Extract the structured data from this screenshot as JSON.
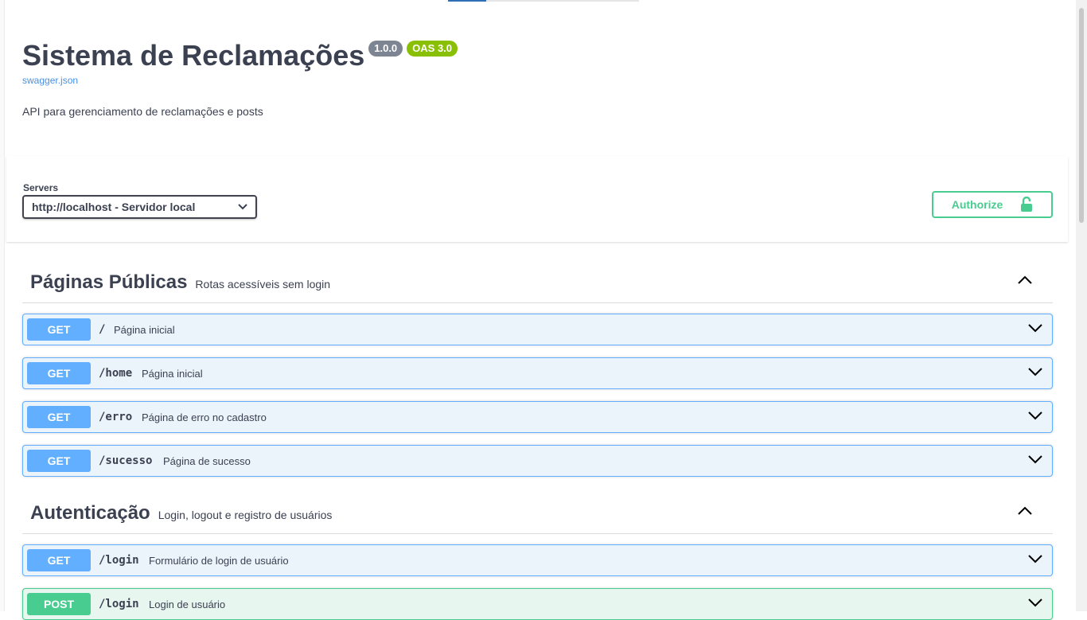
{
  "info": {
    "title": "Sistema de Reclamações",
    "version": "1.0.0",
    "oas": "OAS 3.0",
    "spec_link": "swagger.json",
    "description": "API para gerenciamento de reclamações e posts"
  },
  "servers": {
    "label": "Servers",
    "selected": "http://localhost - Servidor local"
  },
  "authorize": {
    "label": "Authorize"
  },
  "colors": {
    "get": "#61affe",
    "post": "#49cc90",
    "accent": "#4990e2"
  },
  "tags": [
    {
      "name": "Páginas Públicas",
      "description": "Rotas acessíveis sem login",
      "operations": [
        {
          "method": "GET",
          "path": "/",
          "summary": "Página inicial"
        },
        {
          "method": "GET",
          "path": "/home",
          "summary": "Página inicial"
        },
        {
          "method": "GET",
          "path": "/erro",
          "summary": "Página de erro no cadastro"
        },
        {
          "method": "GET",
          "path": "/sucesso",
          "summary": "Página de sucesso"
        }
      ]
    },
    {
      "name": "Autenticação",
      "description": "Login, logout e registro de usuários",
      "operations": [
        {
          "method": "GET",
          "path": "/login",
          "summary": "Formulário de login de usuário"
        },
        {
          "method": "POST",
          "path": "/login",
          "summary": "Login de usuário"
        }
      ]
    }
  ]
}
